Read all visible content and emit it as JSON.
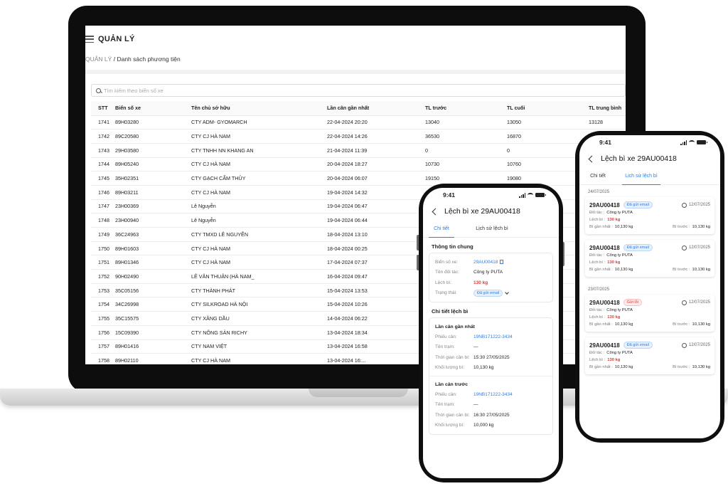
{
  "laptop": {
    "app_title": "QUẢN LÝ",
    "breadcrumb": {
      "parent": "QUẢN LÝ",
      "separator": "/",
      "current": "Danh sách phương tiện"
    },
    "search_placeholder": "Tìm kiếm theo biển số xe",
    "columns": [
      "STT",
      "Biển số xe",
      "Tên chủ sở hữu",
      "Lần cân gần nhất",
      "TL trước",
      "TL cuối",
      "TL trung bình"
    ],
    "rows": [
      [
        "1741",
        "89H03280",
        "CTY ADM- GYOMARCH",
        "22-04-2024 20:20",
        "13040",
        "13050",
        "13128"
      ],
      [
        "1742",
        "89C20580",
        "CTY CJ HÀ NAM",
        "22-04-2024 14:26",
        "36530",
        "16870",
        ""
      ],
      [
        "1743",
        "29H03580",
        "CTY TNHH NN KHANG AN",
        "21-04-2024 11:39",
        "0",
        "0",
        ""
      ],
      [
        "1744",
        "89H05240",
        "CTY CJ HÀ NAM",
        "20-04-2024 18:27",
        "10730",
        "10760",
        ""
      ],
      [
        "1745",
        "35H02351",
        "CTY GẠCH CẨM THỦY",
        "20-04-2024 06:07",
        "19150",
        "19080",
        ""
      ],
      [
        "1746",
        "89H03211",
        "CTY CJ HÀ NAM",
        "19-04-2024 14:32",
        "",
        "",
        ""
      ],
      [
        "1747",
        "23H00369",
        "Lê Nguyễn",
        "19-04-2024 06:47",
        "",
        "",
        ""
      ],
      [
        "1748",
        "23H00940",
        "Lê Nguyễn",
        "19-04-2024 06:44",
        "",
        "",
        ""
      ],
      [
        "1749",
        "36C24963",
        "CTY TMXD LÊ NGUYỄN",
        "18-04-2024 13:10",
        "",
        "",
        ""
      ],
      [
        "1750",
        "89H01603",
        "CTY CJ HÀ NAM",
        "18-04-2024 00:25",
        "",
        "",
        ""
      ],
      [
        "1751",
        "89H01346",
        "CTY CJ HÀ NAM",
        "17-04-2024 07:37",
        "",
        "",
        ""
      ],
      [
        "1752",
        "90H02490",
        "LÊ VĂN THUẬN (HÀ NAM_",
        "16-04-2024 09:47",
        "",
        "",
        ""
      ],
      [
        "1753",
        "35C05156",
        "CTY THÀNH PHÁT",
        "15-04-2024 13:53",
        "",
        "",
        ""
      ],
      [
        "1754",
        "34C26998",
        "CTY SILKROAD HÀ NỘI",
        "15-04-2024 10:26",
        "",
        "",
        ""
      ],
      [
        "1755",
        "35C15575",
        "CTY XĂNG DẦU",
        "14-04-2024 06:22",
        "",
        "",
        ""
      ],
      [
        "1756",
        "15C09390",
        "CTY NÔNG SẢN RICHY",
        "13-04-2024 18:34",
        "",
        "",
        ""
      ],
      [
        "1757",
        "89H01416",
        "CTY NAM VIỆT",
        "13-04-2024 16:58",
        "",
        "",
        ""
      ],
      [
        "1758",
        "89H02110",
        "CTY CJ HÀ NAM",
        "13-04-2024 16:...",
        "",
        "",
        ""
      ]
    ]
  },
  "phone_detail": {
    "time": "9:41",
    "title": "Lệch bì xe 29AU00418",
    "tabs": [
      "Chi tiết",
      "Lịch sử lệch bì"
    ],
    "general_title": "Thông tin chung",
    "general": {
      "plate_label": "Biển số xe:",
      "plate": "29AU00418",
      "partner_label": "Tên đối tác:",
      "partner": "Công ty PUTA",
      "deviation_label": "Lệch bì:",
      "deviation": "130 kg",
      "status_label": "Trạng thái:",
      "status": "Đã gửi email"
    },
    "detail_title": "Chi tiết lệch bì",
    "latest": {
      "title": "Lần cân gần nhất",
      "ticket_label": "Phiếu cân:",
      "ticket": "19NB171222-3434",
      "station_label": "Tên trạm:",
      "station": "—",
      "time_label": "Thời gian cân bì:",
      "time": "15:30 27/05/2025",
      "weight_label": "Khối lượng bì:",
      "weight": "10,130 kg"
    },
    "previous": {
      "title": "Lần cân trước",
      "ticket_label": "Phiếu cân:",
      "ticket": "19NB171222-3434",
      "station_label": "Tên trạm:",
      "station": "—",
      "time_label": "Thời gian cân bì:",
      "time": "16:30 27/05/2025",
      "weight_label": "Khối lượng bì:",
      "weight": "10,000 kg"
    }
  },
  "phone_history": {
    "time": "9:41",
    "title": "Lệch bì xe 29AU00418",
    "tabs": [
      "Chi tiết",
      "Lịch sử lệch bì"
    ],
    "labels": {
      "partner": "Đối tác :",
      "deviation": "Lệch bì :",
      "latest": "Bì gần nhất :",
      "previous": "Bì trước :"
    },
    "groups": [
      {
        "date": "24/07/2025",
        "cards": [
          {
            "plate": "29AU00418",
            "status": "Đã gửi email",
            "status_color": "blue",
            "date": "12/07/2025",
            "partner": "Công ty PUTA",
            "deviation": "130 kg",
            "latest": "10,130 kg",
            "previous": "10,130 kg"
          },
          {
            "plate": "29AU00418",
            "status": "Đã gửi email",
            "status_color": "blue",
            "date": "12/07/2025",
            "partner": "Công ty PUTA",
            "deviation": "130 kg",
            "latest": "10,130 kg",
            "previous": "10,130 kg"
          }
        ]
      },
      {
        "date": "23/07/2025",
        "cards": [
          {
            "plate": "29AU00418",
            "status": "Gửi lỗi",
            "status_color": "red",
            "date": "12/07/2025",
            "partner": "Công ty PUTA",
            "deviation": "130 kg",
            "latest": "10,130 kg",
            "previous": "10,130 kg"
          },
          {
            "plate": "29AU00418",
            "status": "Đã gửi email",
            "status_color": "blue",
            "date": "12/07/2025",
            "partner": "Công ty PUTA",
            "deviation": "130 kg",
            "latest": "10,130 kg",
            "previous": "10,130 kg"
          }
        ]
      }
    ]
  },
  "colors": {
    "link": "#2f7ddd",
    "danger": "#e53935",
    "frame": "#0f0f0f"
  }
}
